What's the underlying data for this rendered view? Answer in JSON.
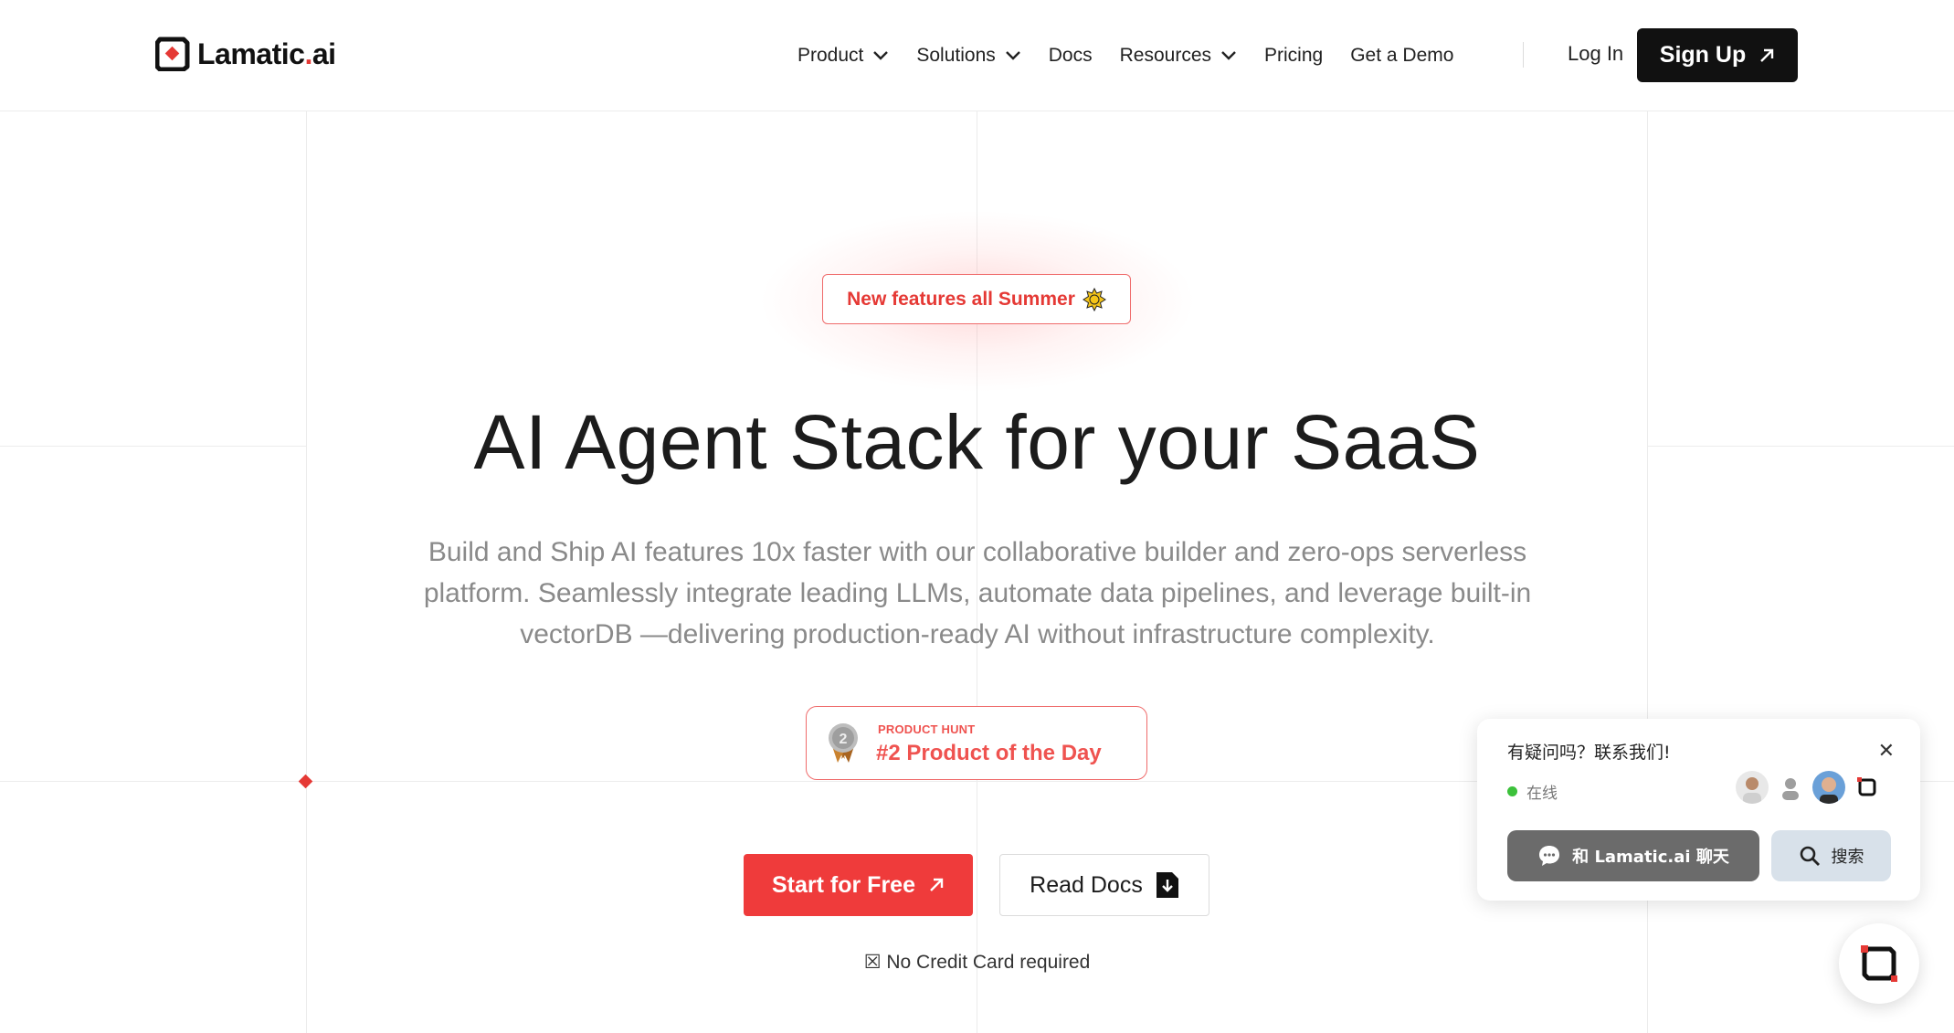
{
  "header": {
    "logo": {
      "text": "Lamatic",
      "dot": ".",
      "suffix": "ai"
    },
    "nav": [
      {
        "label": "Product",
        "has_dropdown": true
      },
      {
        "label": "Solutions",
        "has_dropdown": true
      },
      {
        "label": "Docs",
        "has_dropdown": false
      },
      {
        "label": "Resources",
        "has_dropdown": true
      },
      {
        "label": "Pricing",
        "has_dropdown": false
      },
      {
        "label": "Get a Demo",
        "has_dropdown": false
      }
    ],
    "login_label": "Log In",
    "signup_label": "Sign Up"
  },
  "hero": {
    "badge_label": "New features all Summer",
    "title": "AI Agent Stack for your SaaS",
    "subtitle": "Build and Ship AI features 10x faster with our collaborative builder and zero-ops serverless platform. Seamlessly integrate leading LLMs, automate data pipelines, and leverage built-in vectorDB —delivering production-ready AI without infrastructure complexity.",
    "product_hunt": {
      "small_label": "PRODUCT HUNT",
      "big_label": "#2 Product of the Day",
      "medal_number": "2"
    },
    "primary_cta": "Start for Free",
    "secondary_cta": "Read Docs",
    "no_card_note": "☒ No Credit Card required"
  },
  "chat_widget": {
    "title": "有疑问吗？联系我们!",
    "status": "在线",
    "chat_button": "和 Lamatic.ai 聊天",
    "search_button": "搜索"
  },
  "colors": {
    "accent": "#ef3b3b",
    "dark": "#111111",
    "muted_text": "#8a8a8a",
    "online": "#3cc13b"
  }
}
